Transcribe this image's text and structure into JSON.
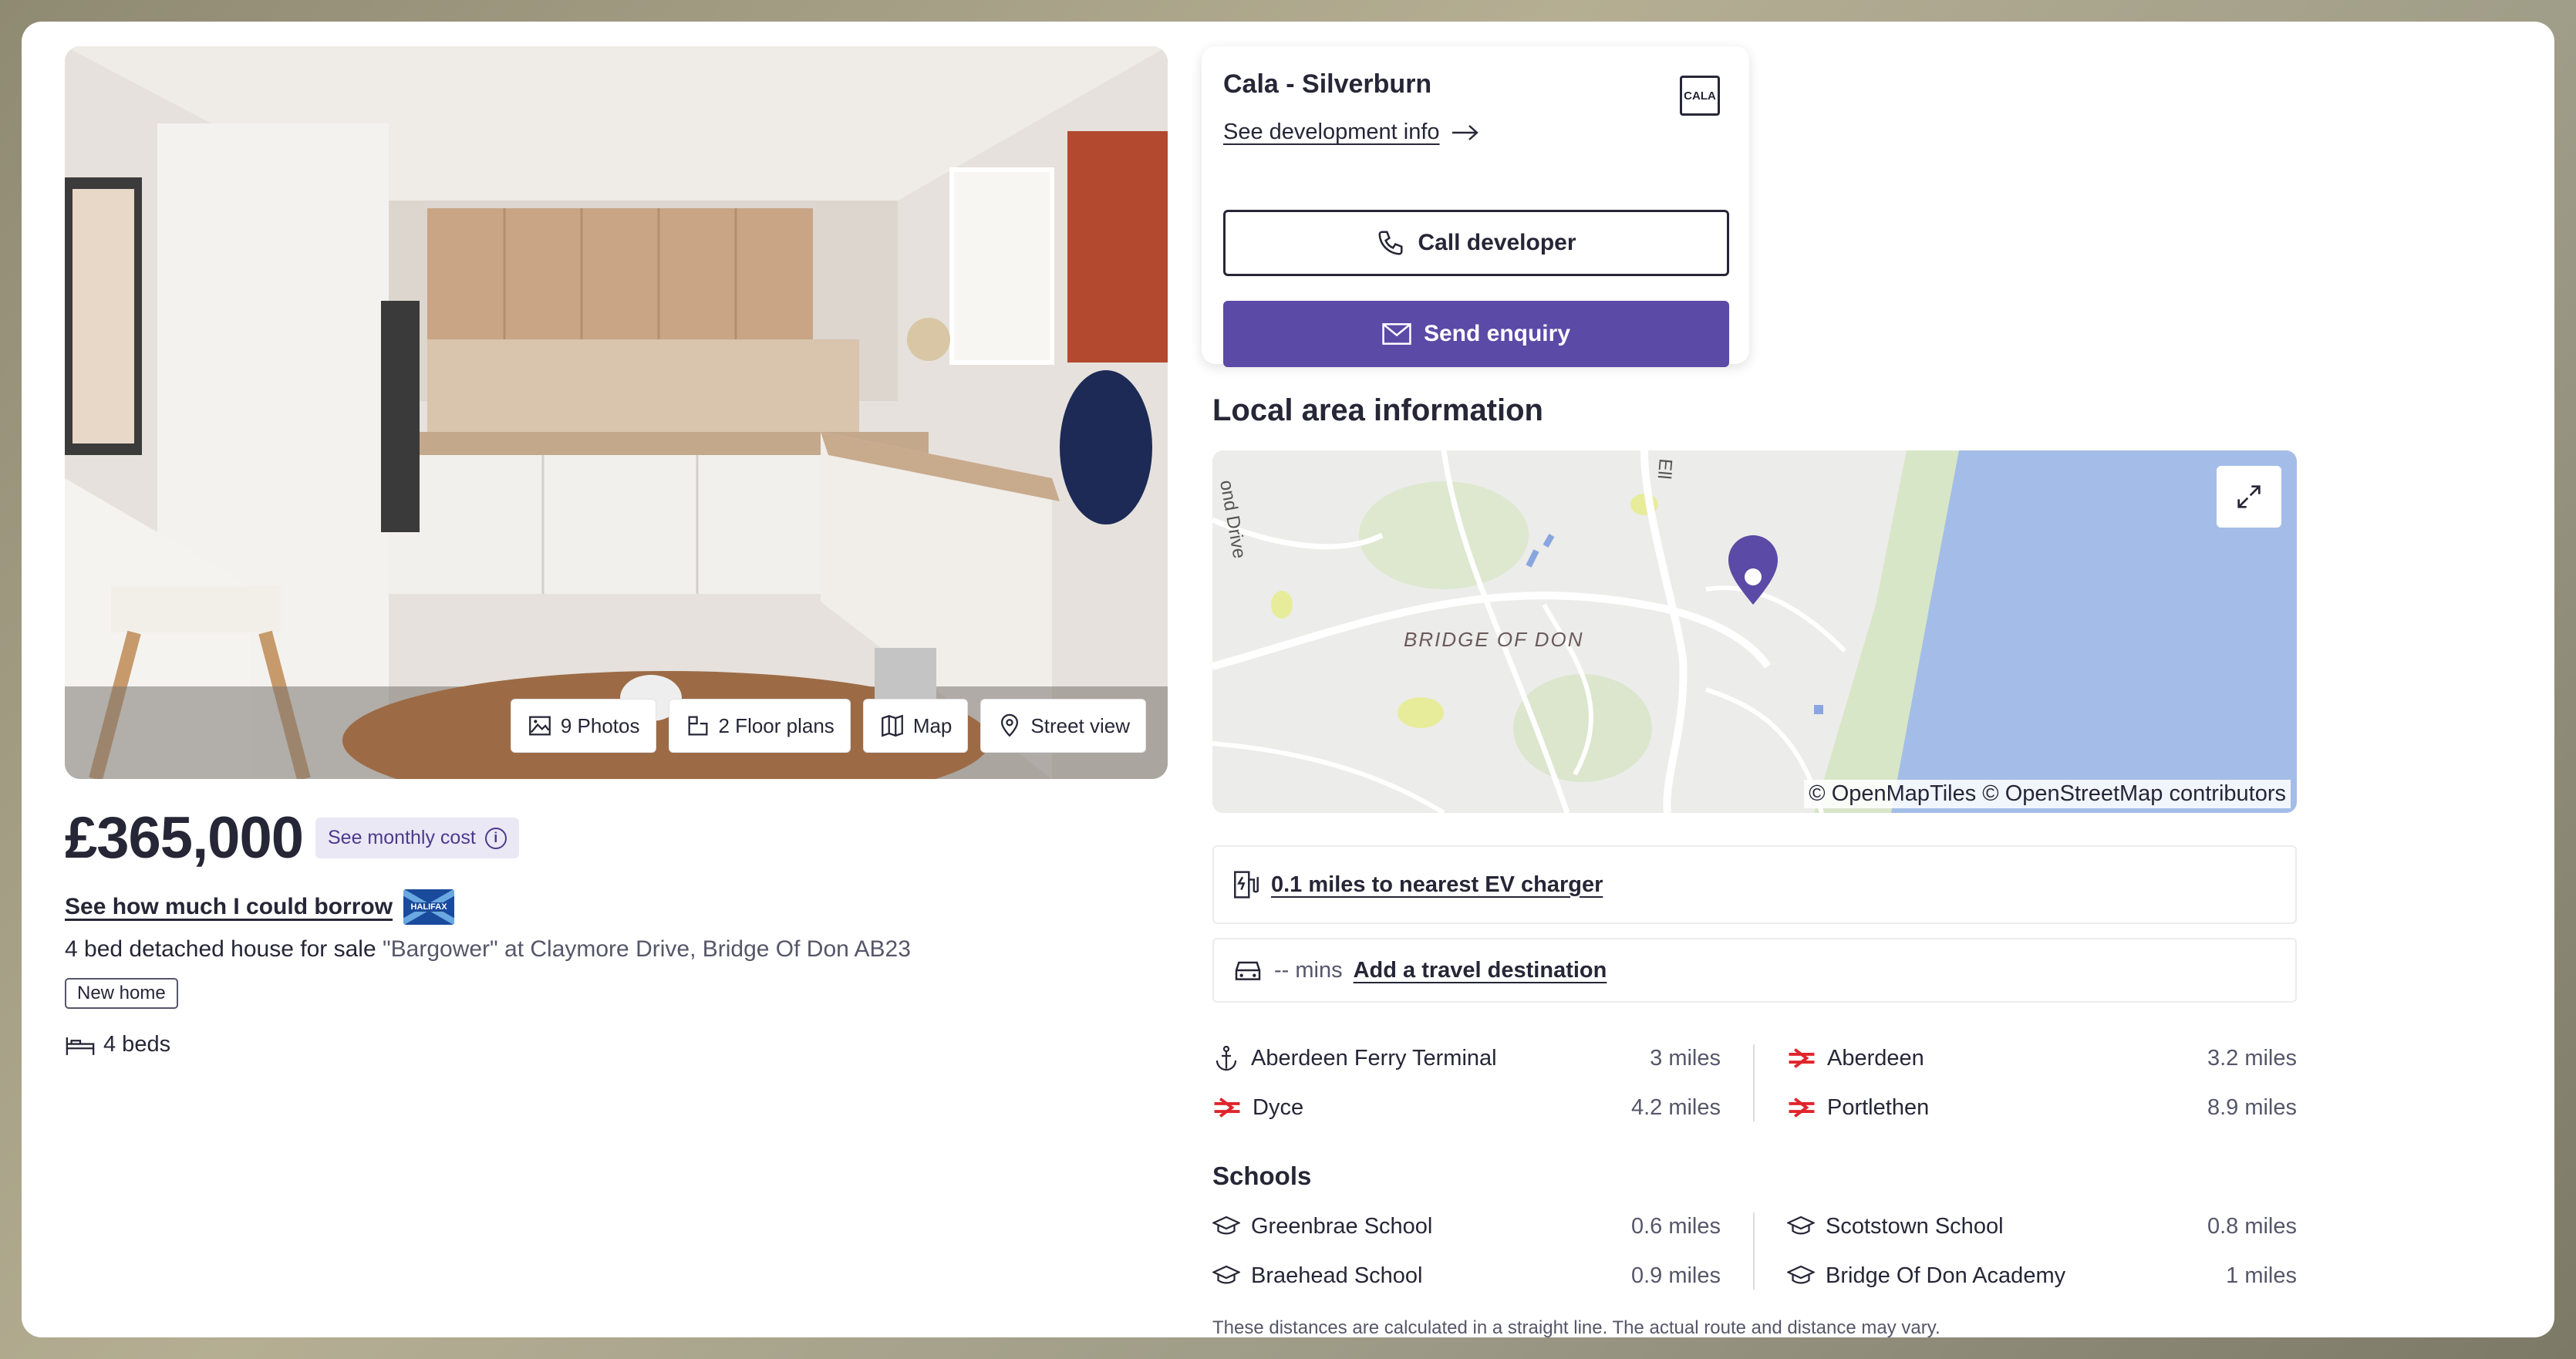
{
  "media": {
    "photos": "9 Photos",
    "floor_plans": "2 Floor plans",
    "map": "Map",
    "street_view": "Street view"
  },
  "listing": {
    "price": "£365,000",
    "monthly_cost": "See monthly cost",
    "borrow_link": "See how much I could borrow",
    "lender_logo": "HALIFAX",
    "type": "4 bed detached house for sale",
    "address": "\"Bargower\" at Claymore Drive, Bridge Of Don AB23",
    "badge": "New home",
    "beds": "4 beds"
  },
  "developer": {
    "name": "Cala - Silverburn",
    "logo": "CALA",
    "info_link": "See development info",
    "call": "Call developer",
    "enquiry": "Send enquiry"
  },
  "local": {
    "title": "Local area information",
    "map_labels": {
      "road1": "ond Drive",
      "area": "BRIDGE OF DON",
      "road2": "Ell"
    },
    "map_credit": "© OpenMapTiles © OpenStreetMap contributors",
    "ev": "0.1 miles to nearest EV charger",
    "travel_mins": "-- mins",
    "travel_link": "Add a travel destination"
  },
  "transport": {
    "left": [
      {
        "name": "Aberdeen Ferry Terminal",
        "distance": "3 miles",
        "icon": "anchor-icon"
      },
      {
        "name": "Dyce",
        "distance": "4.2 miles",
        "icon": "rail-icon"
      }
    ],
    "right": [
      {
        "name": "Aberdeen",
        "distance": "3.2 miles",
        "icon": "rail-icon"
      },
      {
        "name": "Portlethen",
        "distance": "8.9 miles",
        "icon": "rail-icon"
      }
    ]
  },
  "schools": {
    "title": "Schools",
    "left": [
      {
        "name": "Greenbrae School",
        "distance": "0.6 miles"
      },
      {
        "name": "Braehead School",
        "distance": "0.9 miles"
      }
    ],
    "right": [
      {
        "name": "Scotstown School",
        "distance": "0.8 miles"
      },
      {
        "name": "Bridge Of Don Academy",
        "distance": "1 miles"
      }
    ],
    "disclaimer": "These distances are calculated in a straight line. The actual route and distance may vary."
  },
  "colors": {
    "accent": "#5b4aa6",
    "rail": "#e0242b",
    "water": "#a4bde8"
  }
}
